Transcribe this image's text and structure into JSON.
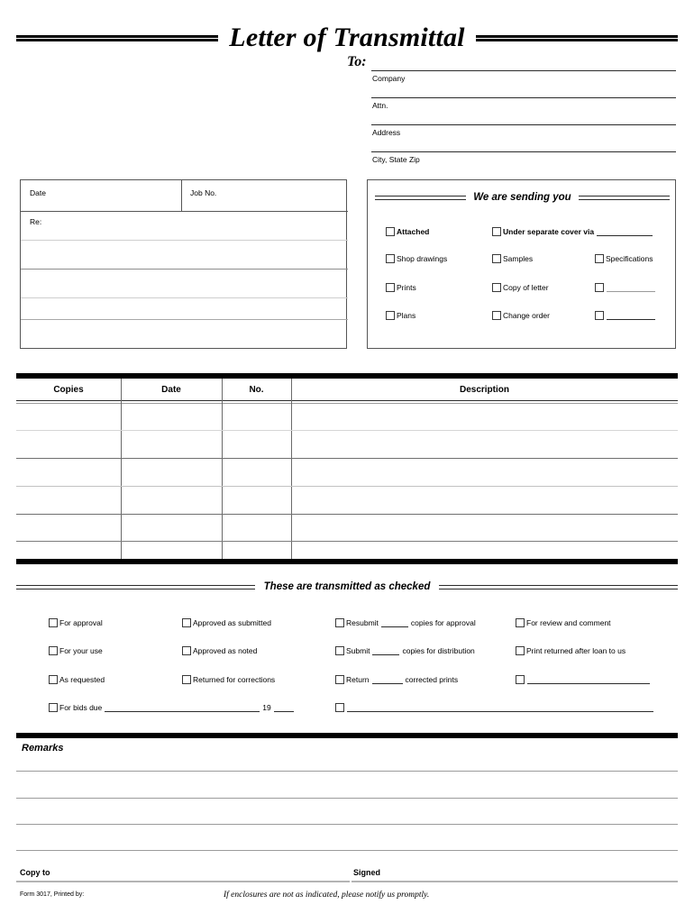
{
  "document": {
    "title": "Letter of Transmittal"
  },
  "to_block": {
    "label": "To:",
    "fields": [
      {
        "caption": "Company"
      },
      {
        "caption": "Attn."
      },
      {
        "caption": "Address"
      },
      {
        "caption": "City, State Zip"
      }
    ]
  },
  "info_box": {
    "date_label": "Date",
    "job_no_label": "Job No.",
    "re_label": "Re:",
    "blank_lines": 4
  },
  "sending_panel": {
    "heading": "We are sending you",
    "rows": [
      [
        {
          "label": "Attached",
          "bold": true,
          "write_in": false
        },
        {
          "label": "Under separate cover via",
          "bold": true,
          "write_in": true
        },
        null
      ],
      [
        {
          "label": "Shop drawings",
          "bold": false,
          "write_in": false
        },
        {
          "label": "Samples",
          "bold": false,
          "write_in": false
        },
        {
          "label": "Specifications",
          "bold": false,
          "write_in": false
        }
      ],
      [
        {
          "label": "Prints",
          "bold": false,
          "write_in": false
        },
        {
          "label": "Copy of letter",
          "bold": false,
          "write_in": false
        },
        {
          "label": "",
          "bold": false,
          "write_in": true
        }
      ],
      [
        {
          "label": "Plans",
          "bold": false,
          "write_in": false
        },
        {
          "label": "Change order",
          "bold": false,
          "write_in": false
        },
        {
          "label": "",
          "bold": false,
          "write_in": true
        }
      ]
    ]
  },
  "items_table": {
    "columns": [
      "Copies",
      "Date",
      "No.",
      "Description"
    ],
    "row_count": 6,
    "rows": [
      {
        "copies": "",
        "date": "",
        "no": "",
        "description": ""
      },
      {
        "copies": "",
        "date": "",
        "no": "",
        "description": ""
      },
      {
        "copies": "",
        "date": "",
        "no": "",
        "description": ""
      },
      {
        "copies": "",
        "date": "",
        "no": "",
        "description": ""
      },
      {
        "copies": "",
        "date": "",
        "no": "",
        "description": ""
      },
      {
        "copies": "",
        "date": "",
        "no": "",
        "description": ""
      }
    ]
  },
  "transmitted": {
    "heading": "These are transmitted as checked",
    "column1": [
      {
        "label": "For approval"
      },
      {
        "label": "For your use"
      },
      {
        "label": "As requested"
      }
    ],
    "column2": [
      {
        "label": "Approved as submitted"
      },
      {
        "label": "Approved as noted"
      },
      {
        "label": "Returned for corrections"
      }
    ],
    "column3": [
      {
        "pre": "Resubmit",
        "post": "copies for approval"
      },
      {
        "pre": "Submit",
        "post": "copies for distribution"
      },
      {
        "pre": "Return",
        "post": "corrected prints"
      }
    ],
    "column4": [
      {
        "label": "For review and comment"
      },
      {
        "label": "Print returned after loan to us"
      },
      {
        "label": ""
      }
    ],
    "bids_due": {
      "pre": "For bids due",
      "year_prefix": "19"
    },
    "blank_row": {
      "label": ""
    }
  },
  "remarks": {
    "label": "Remarks",
    "line_count": 4
  },
  "footer": {
    "copy_to_label": "Copy to",
    "signed_label": "Signed",
    "form_number": "Form 3017, Printed by:",
    "notice": "If enclosures are not as indicated, please notify us promptly."
  },
  "colors": {
    "ink": "#000000",
    "rule": "#2b2b2b",
    "light_rule": "#b9b9b9",
    "box_border": "#555555"
  }
}
